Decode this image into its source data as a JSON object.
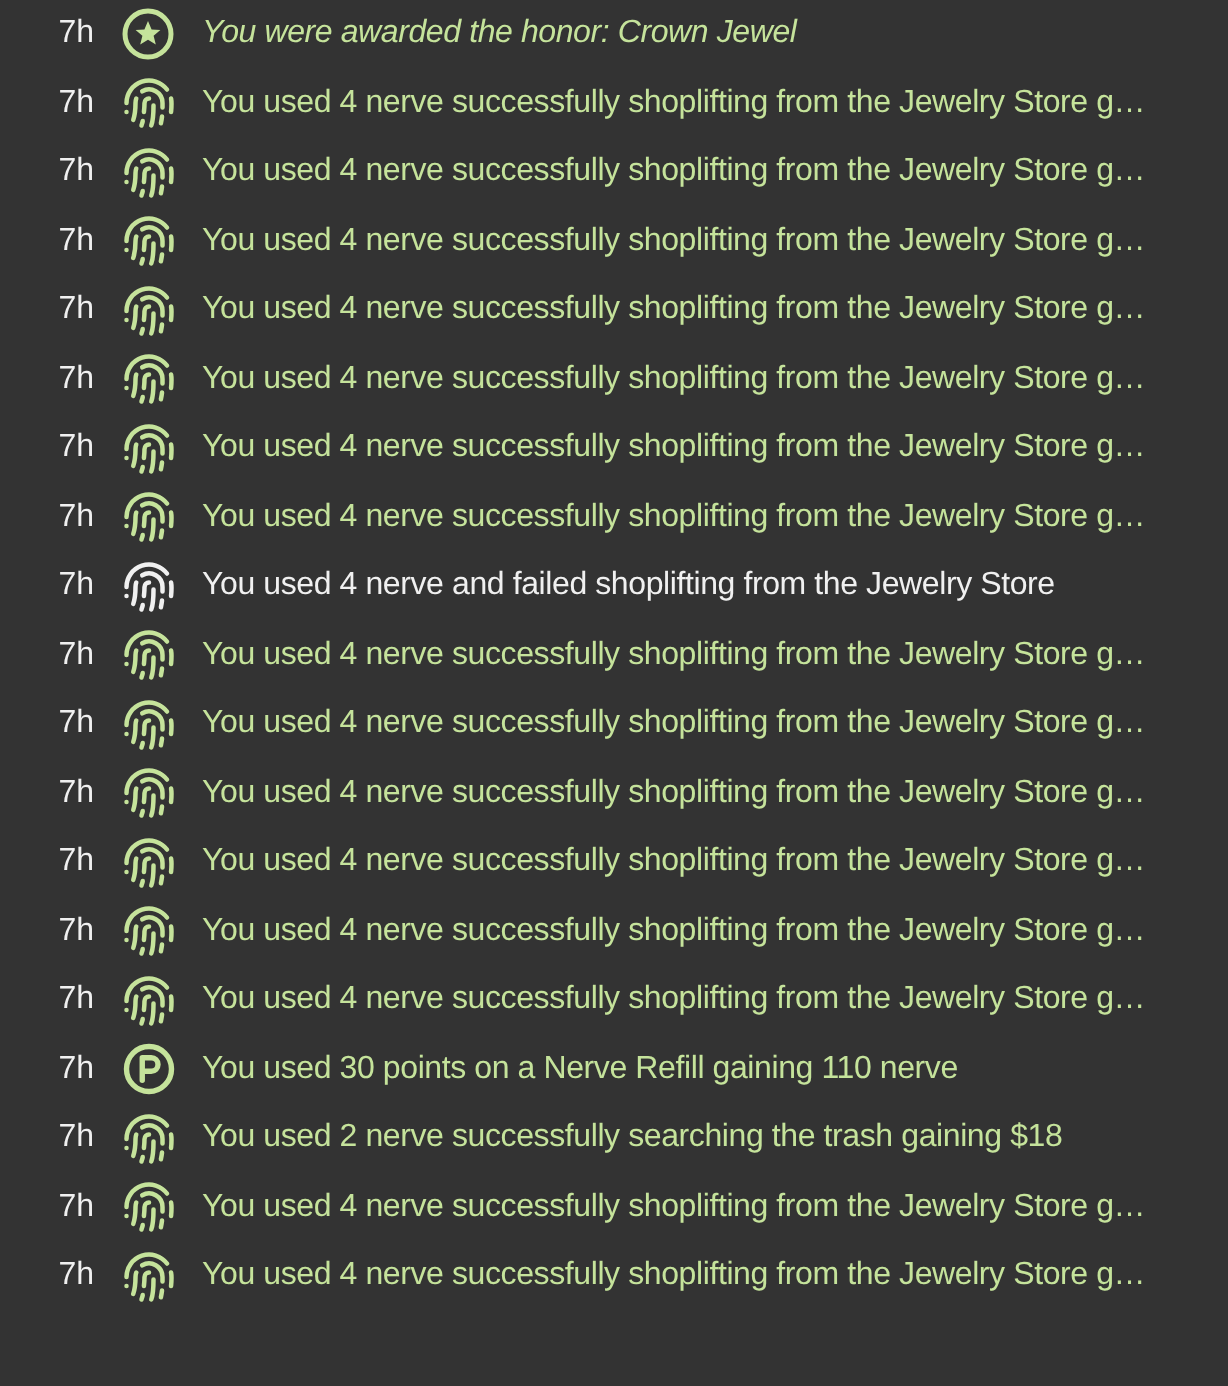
{
  "events": [
    {
      "time": "7h",
      "kind": "award",
      "text": "You were awarded the honor: Crown Jewel"
    },
    {
      "time": "7h",
      "kind": "success",
      "text": "You used 4 nerve successfully shoplifting from the Jewelry Store g…"
    },
    {
      "time": "7h",
      "kind": "success",
      "text": "You used 4 nerve successfully shoplifting from the Jewelry Store g…"
    },
    {
      "time": "7h",
      "kind": "success",
      "text": "You used 4 nerve successfully shoplifting from the Jewelry Store g…"
    },
    {
      "time": "7h",
      "kind": "success",
      "text": "You used 4 nerve successfully shoplifting from the Jewelry Store g…"
    },
    {
      "time": "7h",
      "kind": "success",
      "text": "You used 4 nerve successfully shoplifting from the Jewelry Store g…"
    },
    {
      "time": "7h",
      "kind": "success",
      "text": "You used 4 nerve successfully shoplifting from the Jewelry Store g…"
    },
    {
      "time": "7h",
      "kind": "success",
      "text": "You used 4 nerve successfully shoplifting from the Jewelry Store g…"
    },
    {
      "time": "7h",
      "kind": "fail",
      "text": "You used 4 nerve and failed shoplifting from the Jewelry Store"
    },
    {
      "time": "7h",
      "kind": "success",
      "text": "You used 4 nerve successfully shoplifting from the Jewelry Store g…"
    },
    {
      "time": "7h",
      "kind": "success",
      "text": "You used 4 nerve successfully shoplifting from the Jewelry Store g…"
    },
    {
      "time": "7h",
      "kind": "success",
      "text": "You used 4 nerve successfully shoplifting from the Jewelry Store g…"
    },
    {
      "time": "7h",
      "kind": "success",
      "text": "You used 4 nerve successfully shoplifting from the Jewelry Store g…"
    },
    {
      "time": "7h",
      "kind": "success",
      "text": "You used 4 nerve successfully shoplifting from the Jewelry Store g…"
    },
    {
      "time": "7h",
      "kind": "success",
      "text": "You used 4 nerve successfully shoplifting from the Jewelry Store g…"
    },
    {
      "time": "7h",
      "kind": "points",
      "text": "You used 30 points on a Nerve Refill gaining 110 nerve"
    },
    {
      "time": "7h",
      "kind": "success",
      "text": "You used 2 nerve successfully searching the trash gaining $18"
    },
    {
      "time": "7h",
      "kind": "success",
      "text": "You used 4 nerve successfully shoplifting from the Jewelry Store g…"
    },
    {
      "time": "7h",
      "kind": "success",
      "text": "You used 4 nerve successfully shoplifting from the Jewelry Store g…"
    }
  ]
}
